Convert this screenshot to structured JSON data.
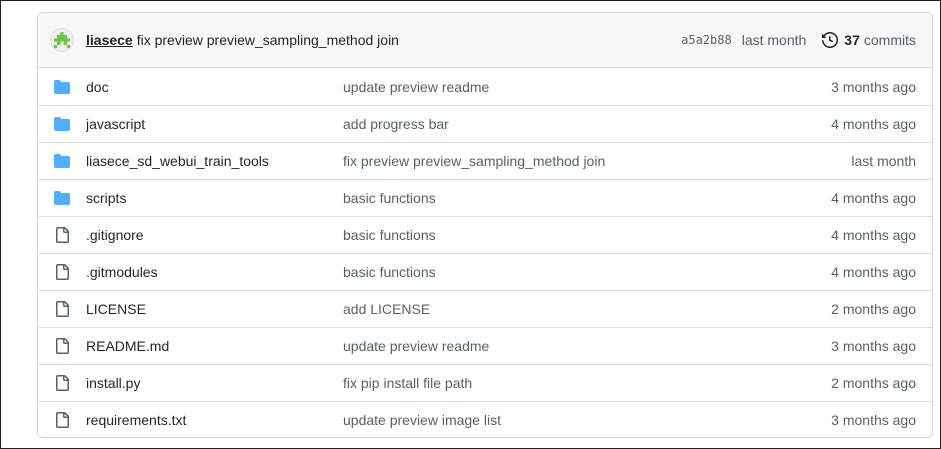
{
  "latest_commit": {
    "author": "liasece",
    "message": "fix preview preview_sampling_method join",
    "sha": "a5a2b88",
    "time": "last month",
    "commits_count": "37",
    "commits_label": "commits"
  },
  "files": [
    {
      "name": "doc",
      "type": "folder",
      "message": "update preview readme",
      "age": "3 months ago"
    },
    {
      "name": "javascript",
      "type": "folder",
      "message": "add progress bar",
      "age": "4 months ago"
    },
    {
      "name": "liasece_sd_webui_train_tools",
      "type": "folder",
      "message": "fix preview preview_sampling_method join",
      "age": "last month"
    },
    {
      "name": "scripts",
      "type": "folder",
      "message": "basic functions",
      "age": "4 months ago"
    },
    {
      "name": ".gitignore",
      "type": "file",
      "message": "basic functions",
      "age": "4 months ago"
    },
    {
      "name": ".gitmodules",
      "type": "file",
      "message": "basic functions",
      "age": "4 months ago"
    },
    {
      "name": "LICENSE",
      "type": "file",
      "message": "add LICENSE",
      "age": "2 months ago"
    },
    {
      "name": "README.md",
      "type": "file",
      "message": "update preview readme",
      "age": "3 months ago"
    },
    {
      "name": "install.py",
      "type": "file",
      "message": "fix pip install file path",
      "age": "2 months ago"
    },
    {
      "name": "requirements.txt",
      "type": "file",
      "message": "update preview image list",
      "age": "3 months ago"
    }
  ],
  "colors": {
    "folder_icon": "#54aeff",
    "file_icon": "#57606a",
    "avatar": "#6cc644"
  }
}
